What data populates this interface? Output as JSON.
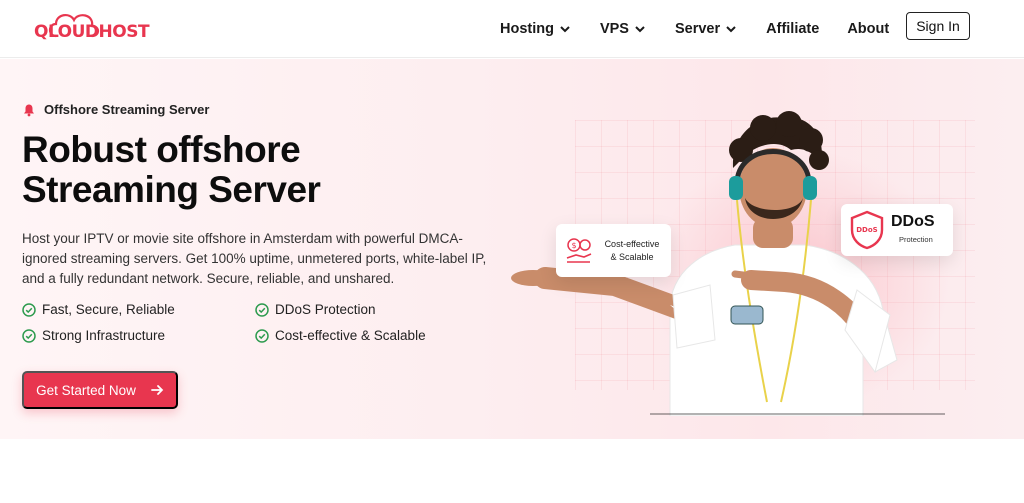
{
  "brand": {
    "logo_text": "QLOUDHOST",
    "accent_color": "#e8364f"
  },
  "header": {
    "nav": [
      {
        "label": "Hosting",
        "has_dropdown": true
      },
      {
        "label": "VPS",
        "has_dropdown": true
      },
      {
        "label": "Server",
        "has_dropdown": true
      },
      {
        "label": "Affiliate",
        "has_dropdown": false
      },
      {
        "label": "About",
        "has_dropdown": false
      }
    ],
    "signin_label": "Sign In"
  },
  "hero": {
    "eyebrow": "Offshore Streaming Server",
    "title_line1": "Robust offshore",
    "title_line2": "Streaming Server",
    "description": "Host your IPTV or movie site offshore in Amsterdam with powerful DMCA-ignored streaming servers. Get 100% uptime, unmetered ports, white-label IP, and a fully redundant network. Secure, reliable, and unshared.",
    "features": [
      "Fast, Secure, Reliable",
      "DDoS Protection",
      "Strong Infrastructure",
      "Cost-effective & Scalable"
    ],
    "cta_label": "Get Started Now"
  },
  "badges": {
    "cost_line1": "Cost-effective",
    "cost_line2": "& Scalable",
    "ddos_title": "DDoS",
    "ddos_subtitle": "Protection",
    "ddos_shield_text": "DDoS"
  },
  "icons": {
    "logo": "cloud-logo-icon",
    "nav_dropdown": "chevron-down-icon",
    "eyebrow": "bell-icon",
    "feature": "check-circle-icon",
    "cta": "arrow-right-icon",
    "cost": "hand-coins-icon",
    "ddos": "shield-check-icon"
  }
}
